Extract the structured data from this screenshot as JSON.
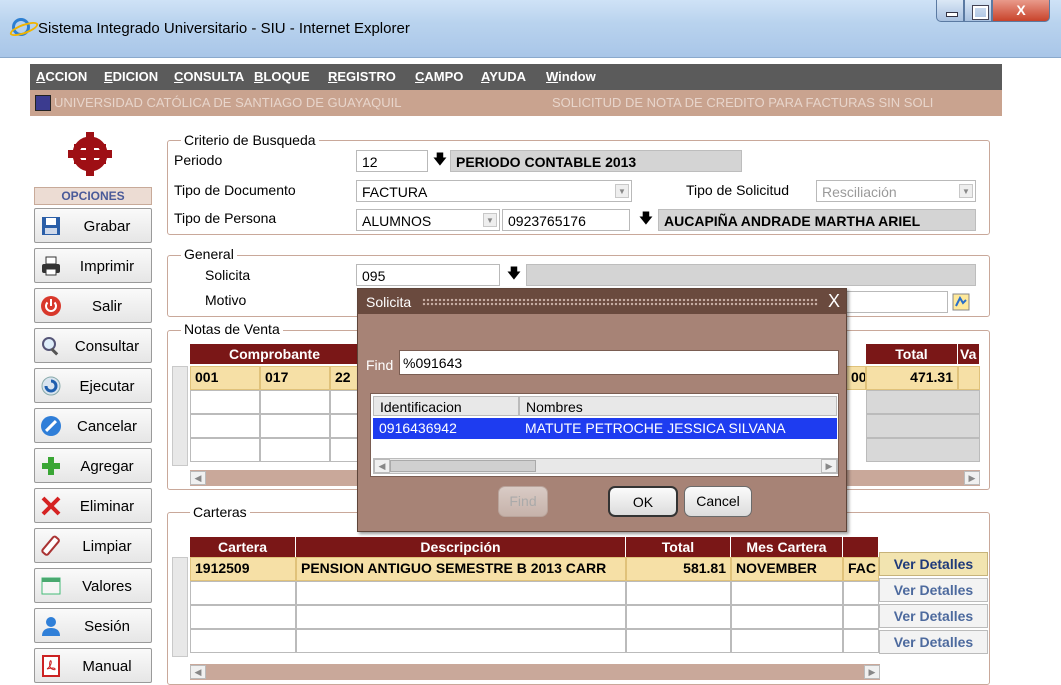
{
  "window": {
    "title": "Sistema Integrado Universitario - SIU - Internet Explorer",
    "close": "X"
  },
  "menu": [
    "ACCION",
    "EDICION",
    "CONSULTA",
    "BLOQUE",
    "REGISTRO",
    "CAMPO",
    "AYUDA",
    "Window"
  ],
  "header": {
    "university": "UNIVERSIDAD CATÓLICA DE SANTIAGO DE GUAYAQUIL",
    "form_title": "SOLICITUD DE NOTA DE CREDITO PARA FACTURAS SIN SOLI"
  },
  "sidebar": {
    "section": "OPCIONES",
    "buttons": [
      "Grabar",
      "Imprimir",
      "Salir",
      "Consultar",
      "Ejecutar",
      "Cancelar",
      "Agregar",
      "Eliminar",
      "Limpiar",
      "Valores",
      "Sesión",
      "Manual"
    ]
  },
  "criterio": {
    "title": "Criterio de Busqueda",
    "periodo_label": "Periodo",
    "periodo_value": "12",
    "periodo_desc": "PERIODO CONTABLE 2013",
    "tipo_doc_label": "Tipo de Documento",
    "tipo_doc_value": "FACTURA",
    "tipo_sol_label": "Tipo de Solicitud",
    "tipo_sol_value": "Resciliación",
    "tipo_persona_label": "Tipo de Persona",
    "tipo_persona_value": "ALUMNOS",
    "persona_id": "0923765176",
    "persona_name": "AUCAPIÑA ANDRADE MARTHA ARIEL"
  },
  "general": {
    "title": "General",
    "solicita_label": "Solicita",
    "solicita_value": "095",
    "motivo_label": "Motivo"
  },
  "notas": {
    "title": "Notas de Venta",
    "headers": {
      "comprobante": "Comprobante",
      "total": "Total",
      "va": "Va"
    },
    "row1": {
      "c1": "001",
      "c2": "017",
      "c3": "22",
      "c4": "00",
      "total": "471.31"
    }
  },
  "carteras": {
    "title": "Carteras",
    "headers": {
      "cartera": "Cartera",
      "descripcion": "Descripción",
      "total": "Total",
      "mes": "Mes Cartera"
    },
    "row1": {
      "cartera": "1912509",
      "descripcion": "PENSION ANTIGUO SEMESTRE B 2013 CARR",
      "total": "581.81",
      "mes": "NOVEMBER",
      "extra": "FAC"
    },
    "ver_detalles": "Ver Detalles"
  },
  "dialog": {
    "title": "Solicita",
    "close": "X",
    "find_label": "Find",
    "find_value": "%091643",
    "columns": [
      "Identificacion",
      "Nombres"
    ],
    "rows": [
      {
        "id": "0916436942",
        "name": "MATUTE PETROCHE JESSICA SILVANA"
      }
    ],
    "buttons": {
      "find": "Find",
      "ok": "OK",
      "cancel": "Cancel"
    }
  }
}
